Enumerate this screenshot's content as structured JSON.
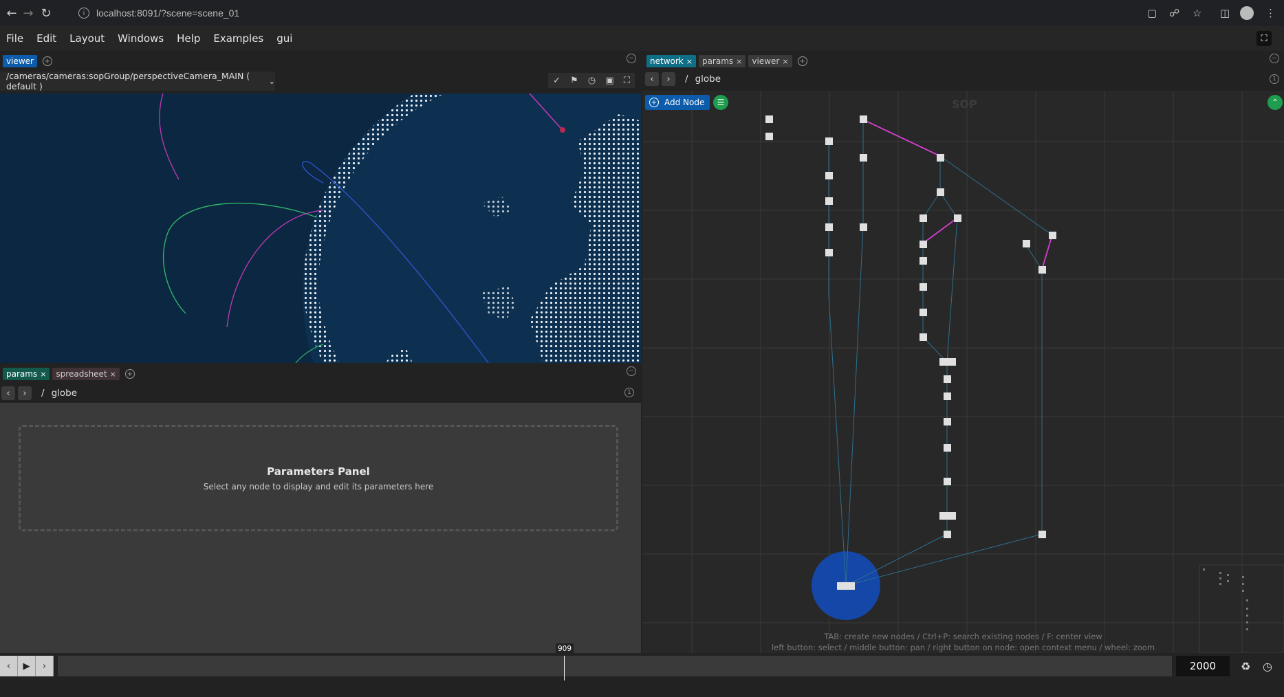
{
  "browser": {
    "url": "localhost:8091/?scene=scene_01"
  },
  "menubar": {
    "items": [
      "File",
      "Edit",
      "Layout",
      "Windows",
      "Help",
      "Examples",
      "gui"
    ]
  },
  "viewer": {
    "tabs": [
      {
        "label": "viewer",
        "active": true
      }
    ],
    "camera_path": "/cameras/cameras:sopGroup/perspectiveCamera_MAIN ( default )"
  },
  "params": {
    "tabs": [
      {
        "label": "params",
        "active": true,
        "closable": true
      },
      {
        "label": "spreadsheet",
        "active": false,
        "closable": true
      }
    ],
    "crumb_sep": "/",
    "crumb": "globe",
    "empty_title": "Parameters Panel",
    "empty_subtitle": "Select any node to display and edit its parameters here"
  },
  "network": {
    "tabs": [
      {
        "label": "network",
        "active": true
      },
      {
        "label": "params",
        "active": false
      },
      {
        "label": "viewer",
        "active": false
      }
    ],
    "crumb_sep": "/",
    "crumb": "globe",
    "add_node_label": "Add Node",
    "context_label": "SOP",
    "help_line1": "TAB: create new nodes / Ctrl+P: search existing nodes / F: center view",
    "help_line2": "left button: select / middle button: pan / right button on node: open context menu / wheel: zoom",
    "accent_color": "#0d5cab",
    "connection_color": "#d43fd0"
  },
  "timeline": {
    "current_frame": "909",
    "current_fraction": 0.4545,
    "end_frame": "2000"
  }
}
